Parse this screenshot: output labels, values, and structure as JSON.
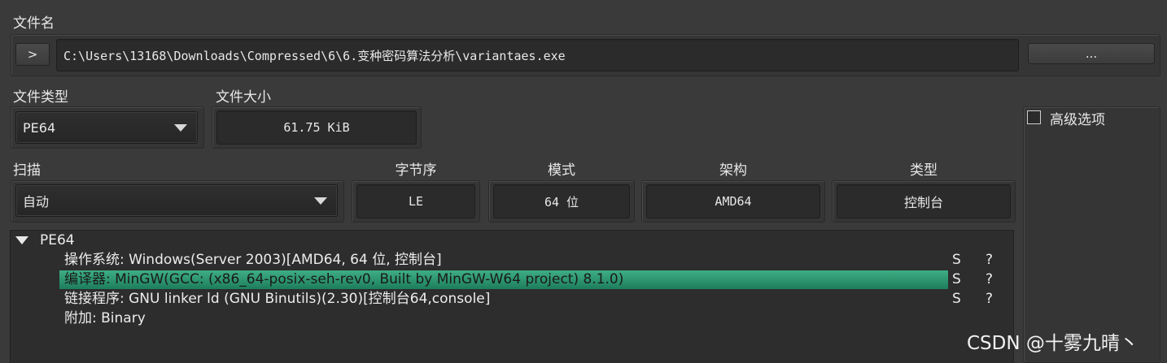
{
  "file": {
    "label": "文件名",
    "expand_button": ">",
    "path": "C:\\Users\\13168\\Downloads\\Compressed\\6\\6.变种密码算法分析\\variantaes.exe",
    "browse_button": "..."
  },
  "file_type": {
    "label": "文件类型",
    "value": "PE64"
  },
  "file_size": {
    "label": "文件大小",
    "value": "61.75 KiB"
  },
  "advanced": {
    "label": "高级选项",
    "checked": false
  },
  "scan": {
    "label": "扫描",
    "value": "自动"
  },
  "info": {
    "endianness": {
      "label": "字节序",
      "value": "LE"
    },
    "mode": {
      "label": "模式",
      "value": "64 位"
    },
    "arch": {
      "label": "架构",
      "value": "AMD64"
    },
    "type": {
      "label": "类型",
      "value": "控制台"
    }
  },
  "tree": {
    "root_label": "PE64",
    "rows": [
      {
        "text": "操作系统: Windows(Server 2003)[AMD64, 64 位, 控制台]",
        "s": "S",
        "q": "?"
      },
      {
        "text": "编译器: MinGW(GCC: (x86_64-posix-seh-rev0, Built by MinGW-W64 project) 8.1.0)",
        "s": "S",
        "q": "?",
        "selected": true
      },
      {
        "text": "链接程序: GNU linker ld (GNU Binutils)(2.30)[控制台64,console]",
        "s": "S",
        "q": "?"
      },
      {
        "text": "附加: Binary"
      }
    ]
  },
  "watermark": "CSDN @十雾九晴丶",
  "colors": {
    "selection": "#2e9a72",
    "background": "#3a3a3a"
  }
}
